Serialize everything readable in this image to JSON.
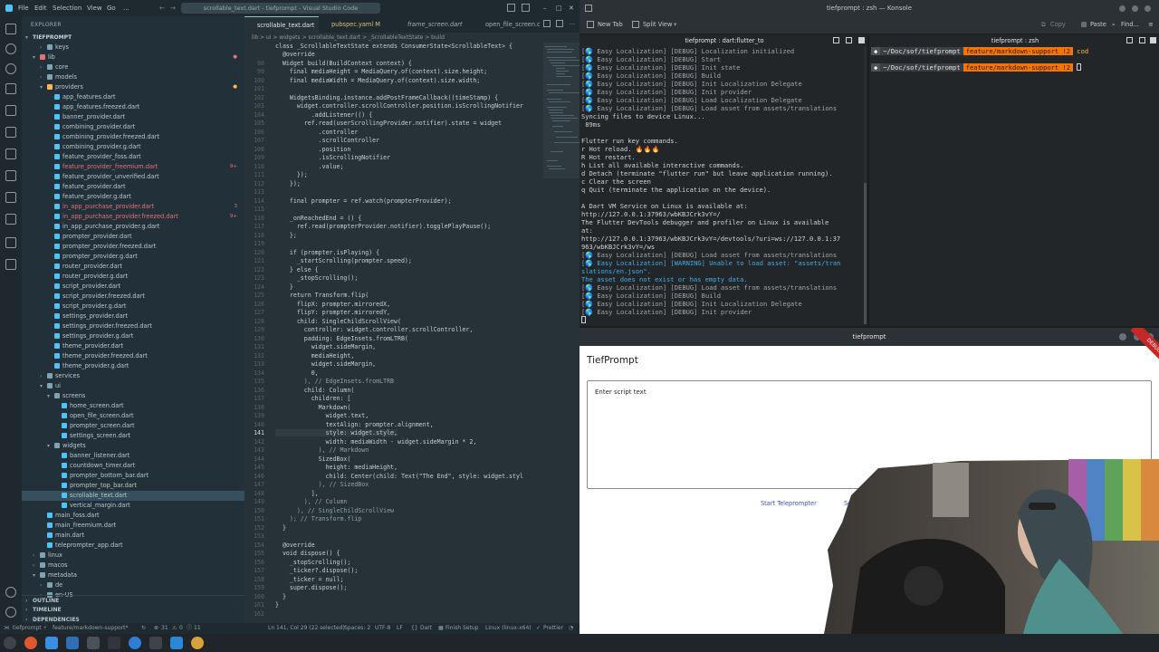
{
  "vscode": {
    "menu": [
      "File",
      "Edit",
      "Selection",
      "View",
      "Go",
      "..."
    ],
    "search_text": "scrollable_text.dart - tiefprompt - Visual Studio Code",
    "explorer_header": "EXPLORER",
    "project": "TIEFPROMPT",
    "tree": [
      {
        "label": "keys",
        "depth": 2,
        "type": "folder",
        "open": false
      },
      {
        "label": "lib",
        "depth": 1,
        "type": "folder",
        "open": true,
        "color": "#e57373"
      },
      {
        "label": "core",
        "depth": 2,
        "type": "folder",
        "open": false
      },
      {
        "label": "models",
        "depth": 2,
        "type": "folder",
        "open": false
      },
      {
        "label": "providers",
        "depth": 2,
        "type": "folder",
        "open": true,
        "color": "#ffb74d"
      },
      {
        "label": "app_features.dart",
        "depth": 3,
        "type": "file"
      },
      {
        "label": "app_features.freezed.dart",
        "depth": 3,
        "type": "file"
      },
      {
        "label": "banner_provider.dart",
        "depth": 3,
        "type": "file"
      },
      {
        "label": "combining_provider.dart",
        "depth": 3,
        "type": "file"
      },
      {
        "label": "combining_provider.freezed.dart",
        "depth": 3,
        "type": "file"
      },
      {
        "label": "combining_provider.g.dart",
        "depth": 3,
        "type": "file"
      },
      {
        "label": "feature_provider_foss.dart",
        "depth": 3,
        "type": "file"
      },
      {
        "label": "feature_provider_freemium.dart",
        "depth": 3,
        "type": "file",
        "color": "#e57373",
        "badge": "9+"
      },
      {
        "label": "feature_provider_unverified.dart",
        "depth": 3,
        "type": "file"
      },
      {
        "label": "feature_provider.dart",
        "depth": 3,
        "type": "file"
      },
      {
        "label": "feature_provider.g.dart",
        "depth": 3,
        "type": "file"
      },
      {
        "label": "in_app_purchase_provider.dart",
        "depth": 3,
        "type": "file",
        "color": "#e57373",
        "badge": "3"
      },
      {
        "label": "in_app_purchase_provider.freezed.dart",
        "depth": 3,
        "type": "file",
        "color": "#e57373",
        "badge": "9+"
      },
      {
        "label": "in_app_purchase_provider.g.dart",
        "depth": 3,
        "type": "file"
      },
      {
        "label": "prompter_provider.dart",
        "depth": 3,
        "type": "file"
      },
      {
        "label": "prompter_provider.freezed.dart",
        "depth": 3,
        "type": "file"
      },
      {
        "label": "prompter_provider.g.dart",
        "depth": 3,
        "type": "file"
      },
      {
        "label": "router_provider.dart",
        "depth": 3,
        "type": "file"
      },
      {
        "label": "router_provider.g.dart",
        "depth": 3,
        "type": "file"
      },
      {
        "label": "script_provider.dart",
        "depth": 3,
        "type": "file"
      },
      {
        "label": "script_provider.freezed.dart",
        "depth": 3,
        "type": "file"
      },
      {
        "label": "script_provider.g.dart",
        "depth": 3,
        "type": "file"
      },
      {
        "label": "settings_provider.dart",
        "depth": 3,
        "type": "file"
      },
      {
        "label": "settings_provider.freezed.dart",
        "depth": 3,
        "type": "file"
      },
      {
        "label": "settings_provider.g.dart",
        "depth": 3,
        "type": "file"
      },
      {
        "label": "theme_provider.dart",
        "depth": 3,
        "type": "file"
      },
      {
        "label": "theme_provider.freezed.dart",
        "depth": 3,
        "type": "file"
      },
      {
        "label": "theme_provider.g.dart",
        "depth": 3,
        "type": "file"
      },
      {
        "label": "services",
        "depth": 2,
        "type": "folder",
        "open": false
      },
      {
        "label": "ui",
        "depth": 2,
        "type": "folder",
        "open": true
      },
      {
        "label": "screens",
        "depth": 3,
        "type": "folder",
        "open": true
      },
      {
        "label": "home_screen.dart",
        "depth": 4,
        "type": "file"
      },
      {
        "label": "open_file_screen.dart",
        "depth": 4,
        "type": "file"
      },
      {
        "label": "prompter_screen.dart",
        "depth": 4,
        "type": "file"
      },
      {
        "label": "settings_screen.dart",
        "depth": 4,
        "type": "file"
      },
      {
        "label": "widgets",
        "depth": 3,
        "type": "folder",
        "open": true
      },
      {
        "label": "banner_listener.dart",
        "depth": 4,
        "type": "file"
      },
      {
        "label": "countdown_timer.dart",
        "depth": 4,
        "type": "file"
      },
      {
        "label": "prompter_bottom_bar.dart",
        "depth": 4,
        "type": "file"
      },
      {
        "label": "prompter_top_bar.dart",
        "depth": 4,
        "type": "file"
      },
      {
        "label": "scrollable_text.dart",
        "depth": 4,
        "type": "file",
        "selected": true
      },
      {
        "label": "vertical_margin.dart",
        "depth": 4,
        "type": "file"
      },
      {
        "label": "main_foss.dart",
        "depth": 2,
        "type": "file"
      },
      {
        "label": "main_freemium.dart",
        "depth": 2,
        "type": "file"
      },
      {
        "label": "main.dart",
        "depth": 2,
        "type": "file"
      },
      {
        "label": "teleprompter_app.dart",
        "depth": 2,
        "type": "file"
      },
      {
        "label": "linux",
        "depth": 1,
        "type": "folder",
        "open": false
      },
      {
        "label": "macos",
        "depth": 1,
        "type": "folder",
        "open": false
      },
      {
        "label": "metadata",
        "depth": 1,
        "type": "folder",
        "open": true
      },
      {
        "label": "de",
        "depth": 2,
        "type": "folder",
        "open": false
      },
      {
        "label": "en-US",
        "depth": 2,
        "type": "folder",
        "open": false
      }
    ],
    "sections": [
      "OUTLINE",
      "TIMELINE",
      "DEPENDENCIES"
    ],
    "tabs": [
      "scrollable_text.dart",
      "pubspec.yaml M",
      "frame_screen.dart",
      "open_file_screen.d"
    ],
    "breadcrumb": "lib > ui > widgets > scrollable_text.dart > _ScrollableTextState > build",
    "sticky_header": "class _ScrollableTextState extends ConsumerState<ScrollableText> {",
    "code": [
      {
        "n": "",
        "t": "  @override"
      },
      {
        "n": "98",
        "t": "  Widget build(BuildContext context) {"
      },
      {
        "n": "99",
        "t": "    final mediaHeight = MediaQuery.of(context).size.height;"
      },
      {
        "n": "100",
        "t": "    final mediaWidth = MediaQuery.of(context).size.width;"
      },
      {
        "n": "101",
        "t": ""
      },
      {
        "n": "102",
        "t": "    WidgetsBinding.instance.addPostFrameCallback((timeStamp) {"
      },
      {
        "n": "103",
        "t": "      widget.controller.scrollController.position.isScrollingNotifier"
      },
      {
        "n": "104",
        "t": "          .addListener(() {"
      },
      {
        "n": "105",
        "t": "        ref.read(userScrollingProvider.notifier).state = widget"
      },
      {
        "n": "106",
        "t": "            .controller"
      },
      {
        "n": "107",
        "t": "            .scrollController"
      },
      {
        "n": "108",
        "t": "            .position"
      },
      {
        "n": "109",
        "t": "            .isScrollingNotifier"
      },
      {
        "n": "110",
        "t": "            .value;"
      },
      {
        "n": "111",
        "t": "      });"
      },
      {
        "n": "112",
        "t": "    });"
      },
      {
        "n": "113",
        "t": ""
      },
      {
        "n": "114",
        "t": "    final prompter = ref.watch(prompterProvider);"
      },
      {
        "n": "115",
        "t": ""
      },
      {
        "n": "116",
        "t": "    _onReachedEnd = () {"
      },
      {
        "n": "117",
        "t": "      ref.read(prompterProvider.notifier).togglePlayPause();"
      },
      {
        "n": "118",
        "t": "    };"
      },
      {
        "n": "119",
        "t": ""
      },
      {
        "n": "120",
        "t": "    if (prompter.isPlaying) {"
      },
      {
        "n": "121",
        "t": "      _startScrolling(prompter.speed);"
      },
      {
        "n": "122",
        "t": "    } else {"
      },
      {
        "n": "123",
        "t": "      _stopScrolling();"
      },
      {
        "n": "124",
        "t": "    }"
      },
      {
        "n": "125",
        "t": "    return Transform.flip("
      },
      {
        "n": "126",
        "t": "      flipX: prompter.mirroredX,"
      },
      {
        "n": "127",
        "t": "      flipY: prompter.mirroredY,"
      },
      {
        "n": "128",
        "t": "      child: SingleChildScrollView("
      },
      {
        "n": "129",
        "t": "        controller: widget.controller.scrollController,"
      },
      {
        "n": "130",
        "t": "        padding: EdgeInsets.fromLTRB("
      },
      {
        "n": "131",
        "t": "          widget.sideMargin,"
      },
      {
        "n": "132",
        "t": "          mediaHeight,"
      },
      {
        "n": "133",
        "t": "          widget.sideMargin,"
      },
      {
        "n": "134",
        "t": "          0,"
      },
      {
        "n": "135",
        "t": "        ), // EdgeInsets.fromLTRB"
      },
      {
        "n": "136",
        "t": "        child: Column("
      },
      {
        "n": "137",
        "t": "          children: ["
      },
      {
        "n": "138",
        "t": "            Markdown("
      },
      {
        "n": "139",
        "t": "              widget.text,"
      },
      {
        "n": "140",
        "t": "              textAlign: prompter.alignment,"
      },
      {
        "n": "141",
        "t": "              style: widget.style,"
      },
      {
        "n": "142",
        "t": "              width: mediaWidth - widget.sideMargin * 2,"
      },
      {
        "n": "143",
        "t": "            ), // Markdown"
      },
      {
        "n": "144",
        "t": "            SizedBox("
      },
      {
        "n": "145",
        "t": "              height: mediaHeight,"
      },
      {
        "n": "146",
        "t": "              child: Center(child: Text(\"The End\", style: widget.styl"
      },
      {
        "n": "147",
        "t": "            ), // SizedBox"
      },
      {
        "n": "148",
        "t": "          ],"
      },
      {
        "n": "149",
        "t": "        ), // Column"
      },
      {
        "n": "150",
        "t": "      ), // SingleChildScrollView"
      },
      {
        "n": "151",
        "t": "    ); // Transform.flip"
      },
      {
        "n": "152",
        "t": "  }"
      },
      {
        "n": "153",
        "t": ""
      },
      {
        "n": "154",
        "t": "  @override"
      },
      {
        "n": "155",
        "t": "  void dispose() {"
      },
      {
        "n": "156",
        "t": "    _stopScrolling();"
      },
      {
        "n": "157",
        "t": "    _ticker?.dispose();"
      },
      {
        "n": "158",
        "t": "    _ticker = null;"
      },
      {
        "n": "159",
        "t": "    super.dispose();"
      },
      {
        "n": "160",
        "t": "  }"
      },
      {
        "n": "161",
        "t": "}"
      },
      {
        "n": "162",
        "t": ""
      }
    ],
    "current_line": "141",
    "status": {
      "branch": "feature/markdown-support*",
      "errors": "31",
      "warnings": "0",
      "info": "11",
      "position": "Ln 141, Col 29 (22 selected)",
      "spaces": "Spaces: 2",
      "encoding": "UTF-8",
      "eol": "LF",
      "language": "Dart",
      "finish": "Finish Setup",
      "device": "Linux (linux-x64)",
      "prettier": "Prettier",
      "project": "tiefprompt"
    }
  },
  "konsole": {
    "title": "tiefprompt : zsh — Konsole",
    "toolbar": {
      "new_tab": "New Tab",
      "split_view": "Split View",
      "copy": "Copy",
      "paste": "Paste",
      "find": "Find..."
    },
    "pane_left_title": "tiefprompt : dart:flutter_to",
    "pane_right_title": "tiefprompt : zsh",
    "lines": [
      {
        "t": "[🌎 Easy Localization] [DEBUG] Localization initialized",
        "c": "dim"
      },
      {
        "t": "[🌎 Easy Localization] [DEBUG] Start",
        "c": "dim"
      },
      {
        "t": "[🌎 Easy Localization] [DEBUG] Init state",
        "c": "dim"
      },
      {
        "t": "[🌎 Easy Localization] [DEBUG] Build",
        "c": "dim"
      },
      {
        "t": "[🌎 Easy Localization] [DEBUG] Init Localization Delegate",
        "c": "dim"
      },
      {
        "t": "[🌎 Easy Localization] [DEBUG] Init provider",
        "c": "dim"
      },
      {
        "t": "[🌎 Easy Localization] [DEBUG] Load Localization Delegate",
        "c": "dim"
      },
      {
        "t": "[🌎 Easy Localization] [DEBUG] Load asset from assets/translations",
        "c": "dim"
      },
      {
        "t": "Syncing files to device Linux...",
        "c": ""
      },
      {
        "t": " 89ms",
        "c": ""
      },
      {
        "t": "",
        "c": ""
      },
      {
        "t": "Flutter run key commands.",
        "c": ""
      },
      {
        "t": "r Hot reload. 🔥🔥🔥",
        "c": ""
      },
      {
        "t": "R Hot restart.",
        "c": ""
      },
      {
        "t": "h List all available interactive commands.",
        "c": ""
      },
      {
        "t": "d Detach (terminate \"flutter run\" but leave application running).",
        "c": ""
      },
      {
        "t": "c Clear the screen",
        "c": ""
      },
      {
        "t": "q Quit (terminate the application on the device).",
        "c": ""
      },
      {
        "t": "",
        "c": ""
      },
      {
        "t": "A Dart VM Service on Linux is available at:",
        "c": ""
      },
      {
        "t": "http://127.0.0.1:37963/wbKBJCrk3vY=/",
        "c": ""
      },
      {
        "t": "The Flutter DevTools debugger and profiler on Linux is available",
        "c": ""
      },
      {
        "t": "at:",
        "c": ""
      },
      {
        "t": "http://127.0.0.1:37963/wbKBJCrk3vY=/devtools/?uri=ws://127.0.0.1:37",
        "c": ""
      },
      {
        "t": "963/wbKBJCrk3vY=/ws",
        "c": ""
      },
      {
        "t": "[🌎 Easy Localization] [DEBUG] Load asset from assets/translations",
        "c": "dim"
      },
      {
        "t": "[🌎 Easy Localization] [WARNING] Unable to load asset: \"assets/tran",
        "c": "warn"
      },
      {
        "t": "slations/en.json\".",
        "c": "warn"
      },
      {
        "t": "The asset does not exist or has empty data.",
        "c": "warn"
      },
      {
        "t": "[🌎 Easy Localization] [DEBUG] Load asset from assets/translations",
        "c": "dim"
      },
      {
        "t": "[🌎 Easy Localization] [DEBUG] Build",
        "c": "dim"
      },
      {
        "t": "[🌎 Easy Localization] [DEBUG] Init Localization Delegate",
        "c": "dim"
      },
      {
        "t": "[🌎 Easy Localization] [DEBUG] Init provider",
        "c": "dim"
      }
    ],
    "prompt": {
      "path": "~/Doc/sof/tiefprompt",
      "git": "feature/markdown-support !2",
      "extra": "cod"
    }
  },
  "app": {
    "window_title": "tiefprompt",
    "appbar_title": "TiefPrompt",
    "script_placeholder": "Enter script text",
    "action_start": "Start Teleprompter",
    "action_second": "Se",
    "debug_banner": "DEBUG"
  },
  "colors": {
    "accent": "#80cbc4",
    "error": "#e57373",
    "prompt_git": "#f67400",
    "warning_text": "#3daee9"
  }
}
